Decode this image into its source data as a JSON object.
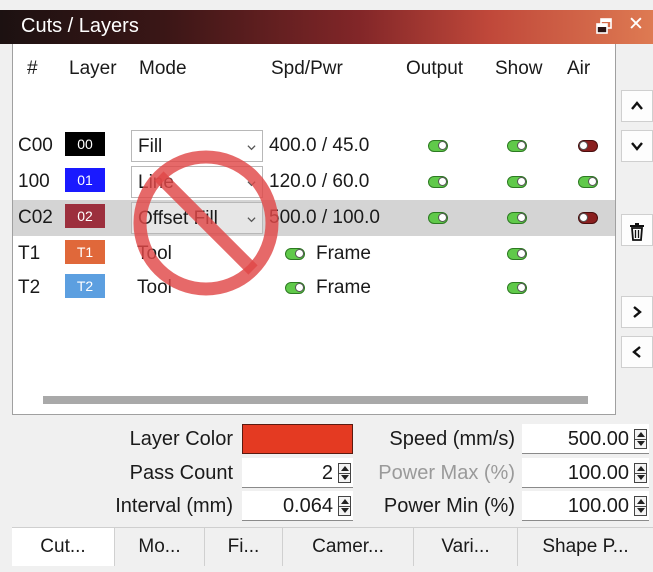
{
  "window": {
    "title": "Cuts / Layers"
  },
  "columns": [
    "#",
    "Layer",
    "Mode",
    "Spd/Pwr",
    "Output",
    "Show",
    "Air"
  ],
  "rows": [
    {
      "num": "C00",
      "layer": "00",
      "swatch": "#000000",
      "mode": "Fill",
      "combo": true,
      "spdpwr": "400.0 / 45.0",
      "output": true,
      "show": true,
      "air": false
    },
    {
      "num": "100",
      "layer": "01",
      "swatch": "#1a1aff",
      "mode": "Line",
      "combo": true,
      "spdpwr": "120.0 / 60.0",
      "output": true,
      "show": true,
      "air": true
    },
    {
      "num": "C02",
      "layer": "02",
      "swatch": "#9c2f3d",
      "mode": "Offset Fill",
      "combo": true,
      "spdpwr": "500.0 / 100.0",
      "output": true,
      "show": true,
      "air": false,
      "selected": true
    },
    {
      "num": "T1",
      "layer": "T1",
      "swatch": "#e0683a",
      "mode": "Tool",
      "combo": false,
      "frame": "Frame",
      "frame_on": true,
      "show": true
    },
    {
      "num": "T2",
      "layer": "T2",
      "swatch": "#5c9fe0",
      "mode": "Tool",
      "combo": false,
      "frame": "Frame",
      "frame_on": true,
      "show": true
    }
  ],
  "properties": {
    "layer_color_label": "Layer Color",
    "layer_color": "#e43a22",
    "pass_count_label": "Pass Count",
    "pass_count": "2",
    "interval_label": "Interval (mm)",
    "interval": "0.064",
    "speed_label": "Speed (mm/s)",
    "speed": "500.00",
    "power_max_label": "Power Max (%)",
    "power_max": "100.00",
    "power_min_label": "Power Min (%)",
    "power_min": "100.00"
  },
  "tabs": [
    "Cut...",
    "Mo...",
    "Fi...",
    "Camer...",
    "Vari...",
    "Shape P..."
  ],
  "colors": {
    "toggle_on": "#60c94a",
    "toggle_off": "#8a1f1f",
    "no_sign": "#e04848"
  },
  "icons": [
    "float-window-icon",
    "close-icon",
    "chevron-up-icon",
    "chevron-down-icon",
    "trash-icon",
    "chevron-right-icon",
    "chevron-left-icon",
    "prohibited-icon"
  ]
}
